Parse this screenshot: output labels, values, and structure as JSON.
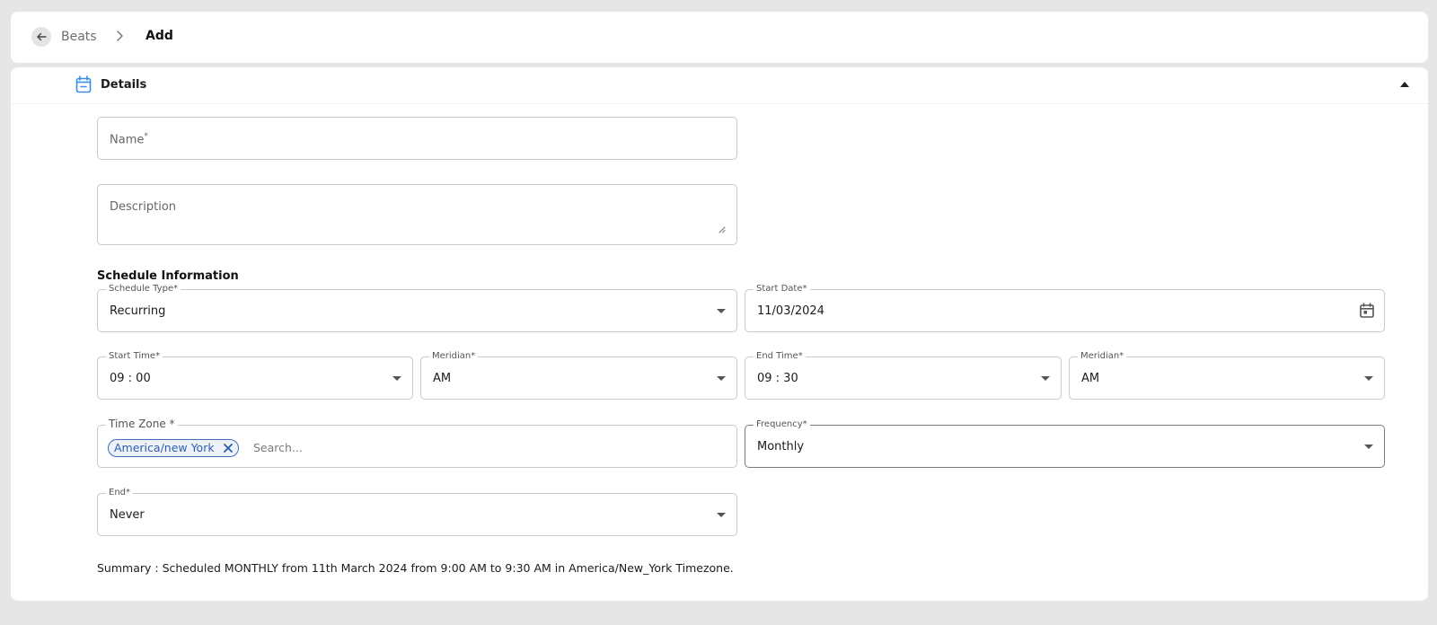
{
  "breadcrumb": {
    "back_icon": "arrow-left-icon",
    "parent": "Beats",
    "current": "Add"
  },
  "details": {
    "title": "Details",
    "icon": "calendar-icon",
    "collapse_icon": "caret-up-icon"
  },
  "form": {
    "name": {
      "label": "Name",
      "required_mark": "*"
    },
    "description": {
      "label": "Description"
    },
    "schedule_section": "Schedule Information",
    "schedule_type": {
      "label": "Schedule Type*",
      "value": "Recurring"
    },
    "start_date": {
      "label": "Start Date*",
      "value": "11/03/2024"
    },
    "start_time": {
      "label": "Start Time*",
      "value": "09 : 00"
    },
    "start_meridian": {
      "label": "Meridian*",
      "value": "AM"
    },
    "end_time": {
      "label": "End Time*",
      "value": "09 : 30"
    },
    "end_meridian": {
      "label": "Meridian*",
      "value": "AM"
    },
    "time_zone": {
      "label": "Time Zone *",
      "chip": "America/new York",
      "search_placeholder": "Search..."
    },
    "frequency": {
      "label": "Frequency*",
      "value": "Monthly"
    },
    "end": {
      "label": "End*",
      "value": "Never"
    }
  },
  "summary": "Summary : Scheduled MONTHLY from 11th March 2024 from 9:00 AM to 9:30 AM in America/New_York Timezone.",
  "colors": {
    "accent": "#2d5da8",
    "calendar_icon": "#3a8ee6",
    "background": "#e6e6e6"
  }
}
